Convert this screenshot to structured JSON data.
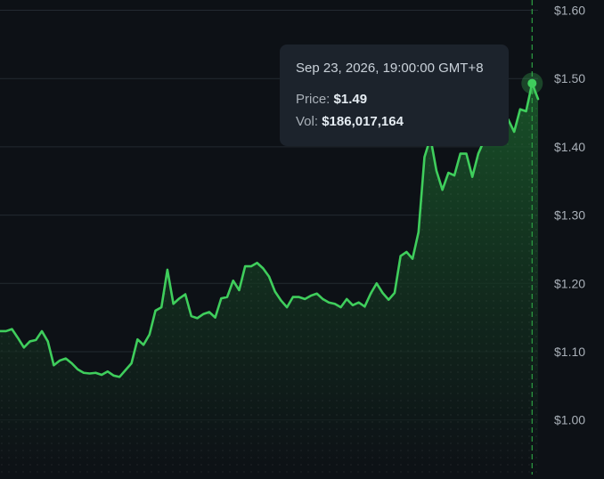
{
  "chart_data": {
    "type": "area",
    "ylim": [
      0.92,
      1.615
    ],
    "y_ticks": [
      "$1.60",
      "$1.50",
      "$1.40",
      "$1.30",
      "$1.20",
      "$1.10",
      "$1.00"
    ],
    "y_tick_values": [
      1.6,
      1.5,
      1.4,
      1.3,
      1.2,
      1.1,
      1.0
    ],
    "grid": true,
    "colors": {
      "line": "#3fce5c",
      "fill_top": "#1b5e2c",
      "fill_bottom": "#0d1116",
      "grid": "#232a31",
      "crosshair": "#2ea043",
      "marker": "#3fce5c"
    },
    "series": [
      {
        "values": [
          1.13,
          1.13,
          1.133,
          1.12,
          1.106,
          1.115,
          1.117,
          1.13,
          1.115,
          1.08,
          1.087,
          1.09,
          1.083,
          1.074,
          1.069,
          1.068,
          1.069,
          1.066,
          1.071,
          1.065,
          1.063,
          1.073,
          1.083,
          1.118,
          1.11,
          1.125,
          1.16,
          1.165,
          1.22,
          1.17,
          1.178,
          1.184,
          1.152,
          1.149,
          1.155,
          1.158,
          1.15,
          1.178,
          1.18,
          1.204,
          1.19,
          1.225,
          1.225,
          1.23,
          1.222,
          1.21,
          1.188,
          1.175,
          1.165,
          1.18,
          1.18,
          1.177,
          1.182,
          1.185,
          1.177,
          1.172,
          1.17,
          1.165,
          1.177,
          1.168,
          1.172,
          1.166,
          1.185,
          1.2,
          1.186,
          1.176,
          1.186,
          1.24,
          1.246,
          1.236,
          1.275,
          1.385,
          1.413,
          1.365,
          1.337,
          1.362,
          1.358,
          1.39,
          1.39,
          1.356,
          1.39,
          1.41,
          1.43,
          1.42,
          1.438,
          1.44,
          1.422,
          1.455,
          1.452,
          1.493,
          1.47
        ]
      }
    ],
    "hover_index": 89,
    "tooltip": {
      "date": "Sep 23, 2026, 19:00:00 GMT+8",
      "price_label": "Price:",
      "price_value": "$1.49",
      "vol_label": "Vol:",
      "vol_value": "$186,017,164"
    }
  }
}
